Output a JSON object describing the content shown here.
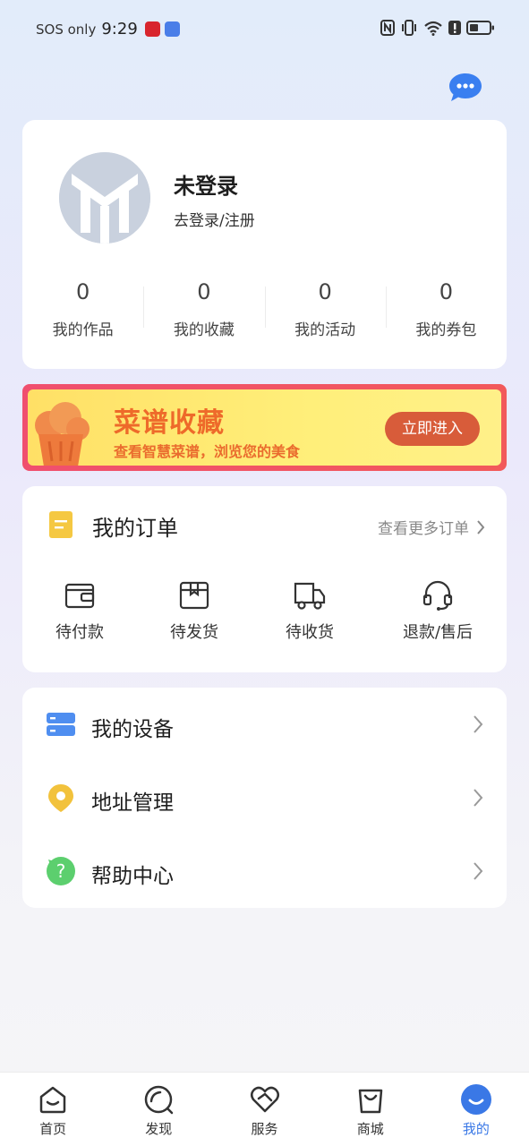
{
  "status_bar": {
    "carrier": "SOS only",
    "time": "9:29"
  },
  "profile": {
    "login_title": "未登录",
    "login_subtitle": "去登录/注册",
    "stats": [
      {
        "count": "0",
        "label": "我的作品"
      },
      {
        "count": "0",
        "label": "我的收藏"
      },
      {
        "count": "0",
        "label": "我的活动"
      },
      {
        "count": "0",
        "label": "我的券包"
      }
    ]
  },
  "banner": {
    "title": "菜谱收藏",
    "subtitle": "查看智慧菜谱，浏览您的美食",
    "button_label": "立即进入",
    "accent_color": "#ee6a2a"
  },
  "orders": {
    "title": "我的订单",
    "more_label": "查看更多订单",
    "items": [
      {
        "label": "待付款",
        "icon": "wallet-icon"
      },
      {
        "label": "待发货",
        "icon": "package-icon"
      },
      {
        "label": "待收货",
        "icon": "truck-icon"
      },
      {
        "label": "退款/售后",
        "icon": "headset-icon"
      }
    ]
  },
  "menu": {
    "items": [
      {
        "label": "我的设备",
        "icon": "device-icon",
        "color": "#4f8ef0"
      },
      {
        "label": "地址管理",
        "icon": "location-icon",
        "color": "#f2c23c"
      },
      {
        "label": "帮助中心",
        "icon": "help-icon",
        "color": "#5ccf6e"
      }
    ]
  },
  "tabbar": {
    "items": [
      {
        "label": "首页",
        "icon": "home-icon"
      },
      {
        "label": "发现",
        "icon": "discover-icon"
      },
      {
        "label": "服务",
        "icon": "service-icon"
      },
      {
        "label": "商城",
        "icon": "shop-icon"
      },
      {
        "label": "我的",
        "icon": "profile-icon",
        "active": true
      }
    ],
    "active_color": "#3a78e6"
  }
}
